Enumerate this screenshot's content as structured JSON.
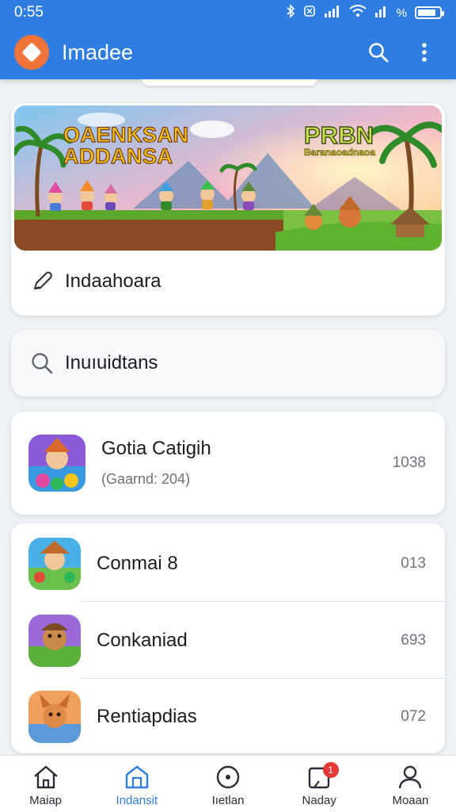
{
  "status_bar": {
    "time": "0:55",
    "battery_level": 0.85,
    "percent_label": "%"
  },
  "app_bar": {
    "title": "Imadee",
    "icons": [
      "search-icon",
      "more-vert-icon"
    ],
    "brand_color": "#2f7de0",
    "logo_color": "#f0743a"
  },
  "banner": {
    "title_line1": "OAENKSAN",
    "title_line2": "ADDANSA",
    "badge_title": "PRBN",
    "badge_sub": "Baranaoadnaoa",
    "action_label": "Indaahoara",
    "action_icon": "pencil-icon"
  },
  "search": {
    "placeholder": "Inuıuidtans",
    "icon": "search-icon"
  },
  "featured": {
    "name": "Gotia Catigih",
    "meta": "(Gaarnd: 204)",
    "count": "1038"
  },
  "list": [
    {
      "name": "Conmai 8",
      "count": "013"
    },
    {
      "name": "Conkaniad",
      "count": "693"
    },
    {
      "name": "Rentiapdias",
      "count": "072"
    }
  ],
  "bottom_nav": [
    {
      "label": "Maiap",
      "icon": "home-icon"
    },
    {
      "label": "Indansit",
      "icon": "store-icon",
      "active": true
    },
    {
      "label": "Iıetlan",
      "icon": "compass-icon"
    },
    {
      "label": "Naday",
      "icon": "notifications-icon",
      "badge": "1"
    },
    {
      "label": "Moaan",
      "icon": "profile-icon"
    }
  ],
  "accent_color": "#2f7de0",
  "badge_color": "#e53935"
}
